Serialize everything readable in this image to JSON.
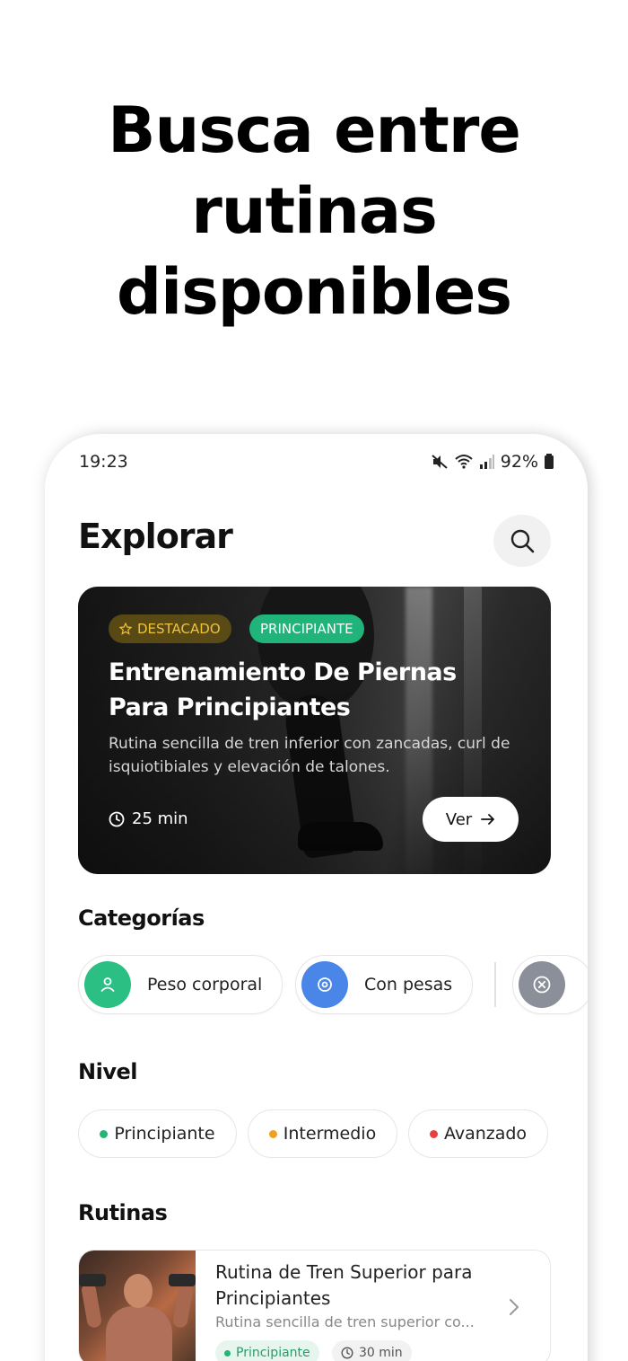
{
  "headline": {
    "line1": "Busca entre",
    "line2": "rutinas",
    "line3": "disponibles"
  },
  "status_bar": {
    "time": "19:23",
    "battery": "92%"
  },
  "header": {
    "title": "Explorar",
    "search_icon": "search-icon"
  },
  "hero": {
    "badge_featured": "DESTACADO",
    "badge_level": "PRINCIPIANTE",
    "title_line1": "Entrenamiento De Piernas",
    "title_line2": "Para Principiantes",
    "description": "Rutina sencilla de tren inferior con zancadas, curl de isquiotibiales y elevación de talones.",
    "duration": "25 min",
    "cta_label": "Ver"
  },
  "categories": {
    "title": "Categorías",
    "items": [
      {
        "label": "Peso corporal",
        "icon": "user-icon",
        "color": "#2bbf84"
      },
      {
        "label": "Con pesas",
        "icon": "target-icon",
        "color": "#4a86e8"
      },
      {
        "label": "",
        "icon": "close-circle-icon",
        "color": "#8a8f99"
      }
    ]
  },
  "levels": {
    "title": "Nivel",
    "items": [
      {
        "label": "Principiante",
        "color": "#22b573"
      },
      {
        "label": "Intermedio",
        "color": "#f0a020"
      },
      {
        "label": "Avanzado",
        "color": "#e84040"
      }
    ]
  },
  "routines": {
    "title": "Rutinas",
    "items": [
      {
        "title": "Rutina de Tren Superior para Principiantes",
        "description": "Rutina sencilla de tren superior co...",
        "level": "Principiante",
        "duration": "30 min"
      }
    ]
  }
}
